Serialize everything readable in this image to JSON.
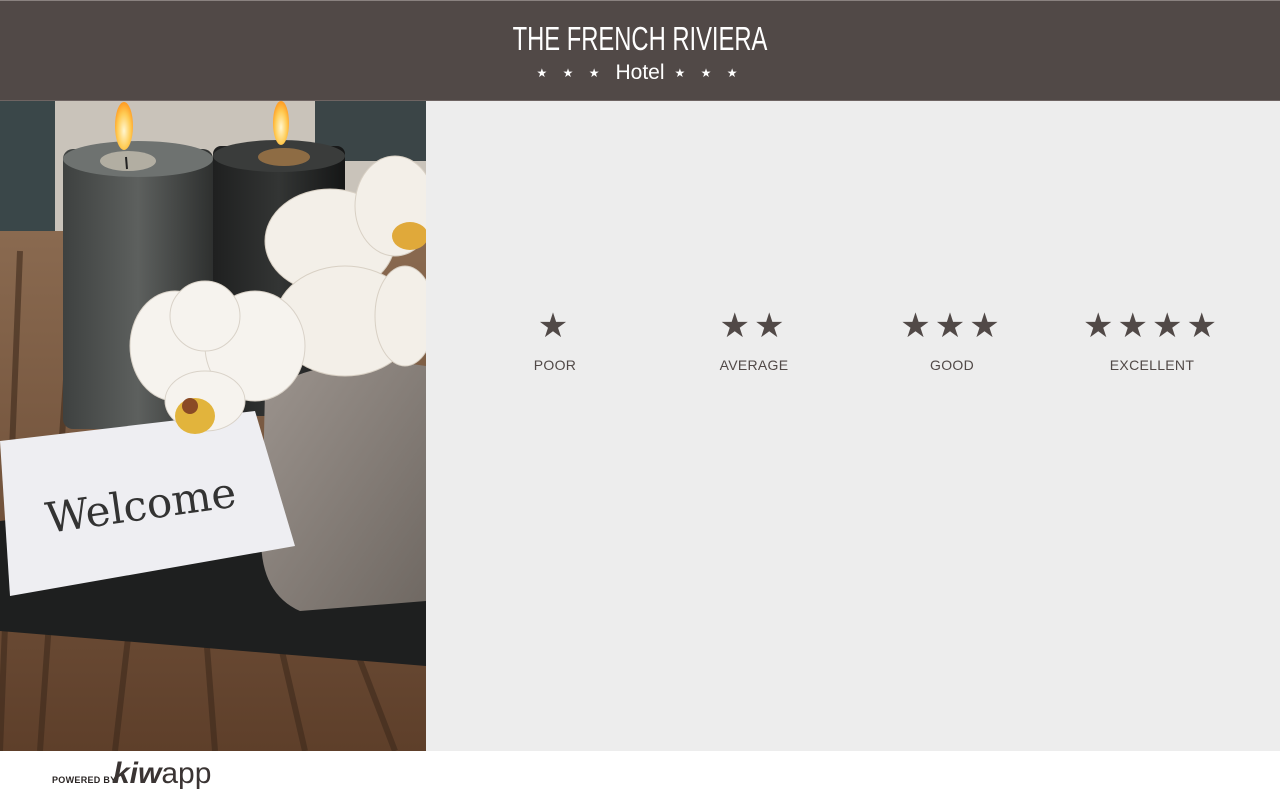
{
  "header": {
    "title": "THE FRENCH RIVIERA",
    "subtitle": "Hotel",
    "stars_left": "★ ★ ★",
    "stars_right": "★ ★ ★"
  },
  "photo": {
    "card_text": "Welcome"
  },
  "ratings": [
    {
      "stars": "★",
      "label": "POOR",
      "level": 1
    },
    {
      "stars": "★★",
      "label": "AVERAGE",
      "level": 2
    },
    {
      "stars": "★★★",
      "label": "GOOD",
      "level": 3
    },
    {
      "stars": "★★★★",
      "label": "EXCELLENT",
      "level": 4
    }
  ],
  "footer": {
    "powered_by": "POWERED BY",
    "brand_bold": "kiw",
    "brand_light": "app"
  },
  "colors": {
    "header_bg": "#514947",
    "panel_bg": "#ededed",
    "accent": "#514947"
  }
}
